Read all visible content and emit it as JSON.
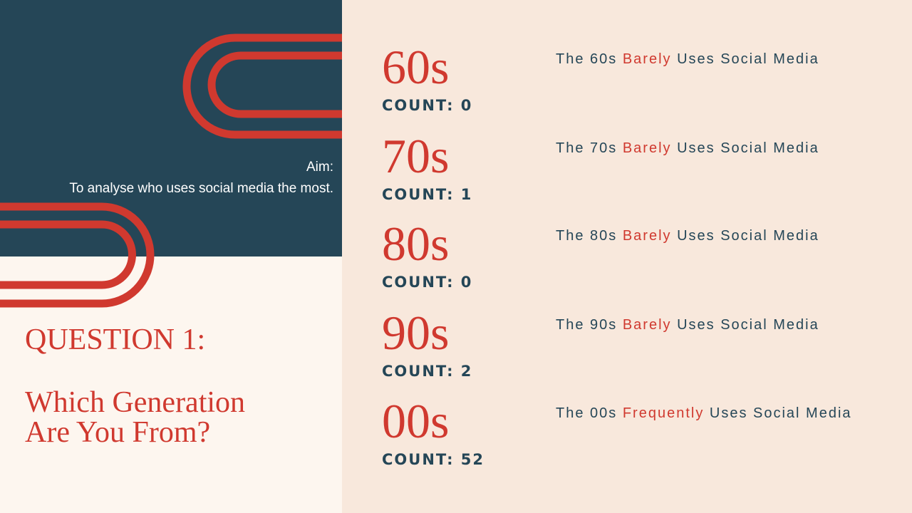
{
  "aim": {
    "label": "Aim:",
    "text": "To analyse who uses social media the most."
  },
  "question": {
    "title": "QUESTION 1:",
    "subtitle_line1": "Which Generation",
    "subtitle_line2": "Are You From?"
  },
  "generations": [
    {
      "label": "60s",
      "count": "COUNT: 0",
      "desc_prefix": "The 60s",
      "desc_highlight": "Barely",
      "desc_suffix": "Uses Social Media"
    },
    {
      "label": "70s",
      "count": "COUNT: 1",
      "desc_prefix": "The 70s",
      "desc_highlight": "Barely",
      "desc_suffix": "Uses Social Media"
    },
    {
      "label": "80s",
      "count": "COUNT: 0",
      "desc_prefix": "The 80s",
      "desc_highlight": "Barely",
      "desc_suffix": "Uses Social Media"
    },
    {
      "label": "90s",
      "count": "COUNT: 2",
      "desc_prefix": "The 90s",
      "desc_highlight": "Barely",
      "desc_suffix": "Uses Social Media"
    },
    {
      "label": "00s",
      "count": "COUNT: 52",
      "desc_prefix": "The 00s",
      "desc_highlight": "Frequently",
      "desc_suffix": "Uses Social Media"
    }
  ],
  "colors": {
    "navy": "#254657",
    "red": "#d0392f",
    "cream": "#fdf6ef",
    "peach": "#f8e8dc"
  }
}
